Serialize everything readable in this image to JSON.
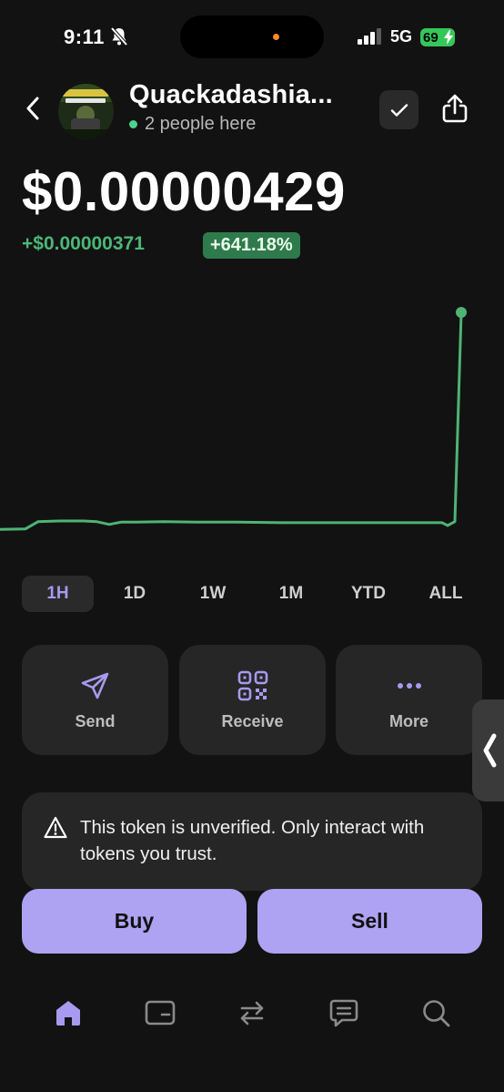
{
  "status": {
    "time": "9:11",
    "network": "5G",
    "battery": "69"
  },
  "header": {
    "token_name": "Quackadashia...",
    "presence": "2 people here"
  },
  "price": {
    "value": "$0.00000429",
    "change": "+$0.00000371",
    "change_pct": "+641.18%"
  },
  "chart_data": {
    "type": "line",
    "x": [
      0,
      1,
      2,
      3,
      4,
      5,
      6,
      7,
      8,
      9,
      10,
      11,
      12,
      13,
      14,
      15,
      16,
      17,
      18,
      19,
      20,
      21,
      22,
      23
    ],
    "y": [
      4.4e-07,
      4.5e-07,
      5.8e-07,
      5.9e-07,
      5.9e-07,
      5.8e-07,
      5.3e-07,
      5.7e-07,
      5.7e-07,
      5.8e-07,
      5.7e-07,
      5.7e-07,
      5.6e-07,
      5.6e-07,
      5.6e-07,
      5.6e-07,
      5.6e-07,
      5.6e-07,
      5.6e-07,
      5.6e-07,
      5.6e-07,
      5.1e-07,
      5.8e-07,
      4.29e-06
    ],
    "ylim": [
      3e-07,
      4.5e-06
    ],
    "color": "#4fb374",
    "grid": false,
    "xlabel": "",
    "ylabel": ""
  },
  "ranges": [
    "1H",
    "1D",
    "1W",
    "1M",
    "YTD",
    "ALL"
  ],
  "selected_range": "1H",
  "actions": {
    "send": "Send",
    "receive": "Receive",
    "more": "More"
  },
  "warning": "This token is unverified. Only interact with tokens you trust.",
  "trade": {
    "buy": "Buy",
    "sell": "Sell"
  },
  "tabs": [
    "home-icon",
    "wallet-icon",
    "swap-icon",
    "chat-icon",
    "search-icon"
  ],
  "colors": {
    "accent": "#aea2f2",
    "positive": "#4cb777",
    "background": "#121212",
    "card": "#262626"
  }
}
